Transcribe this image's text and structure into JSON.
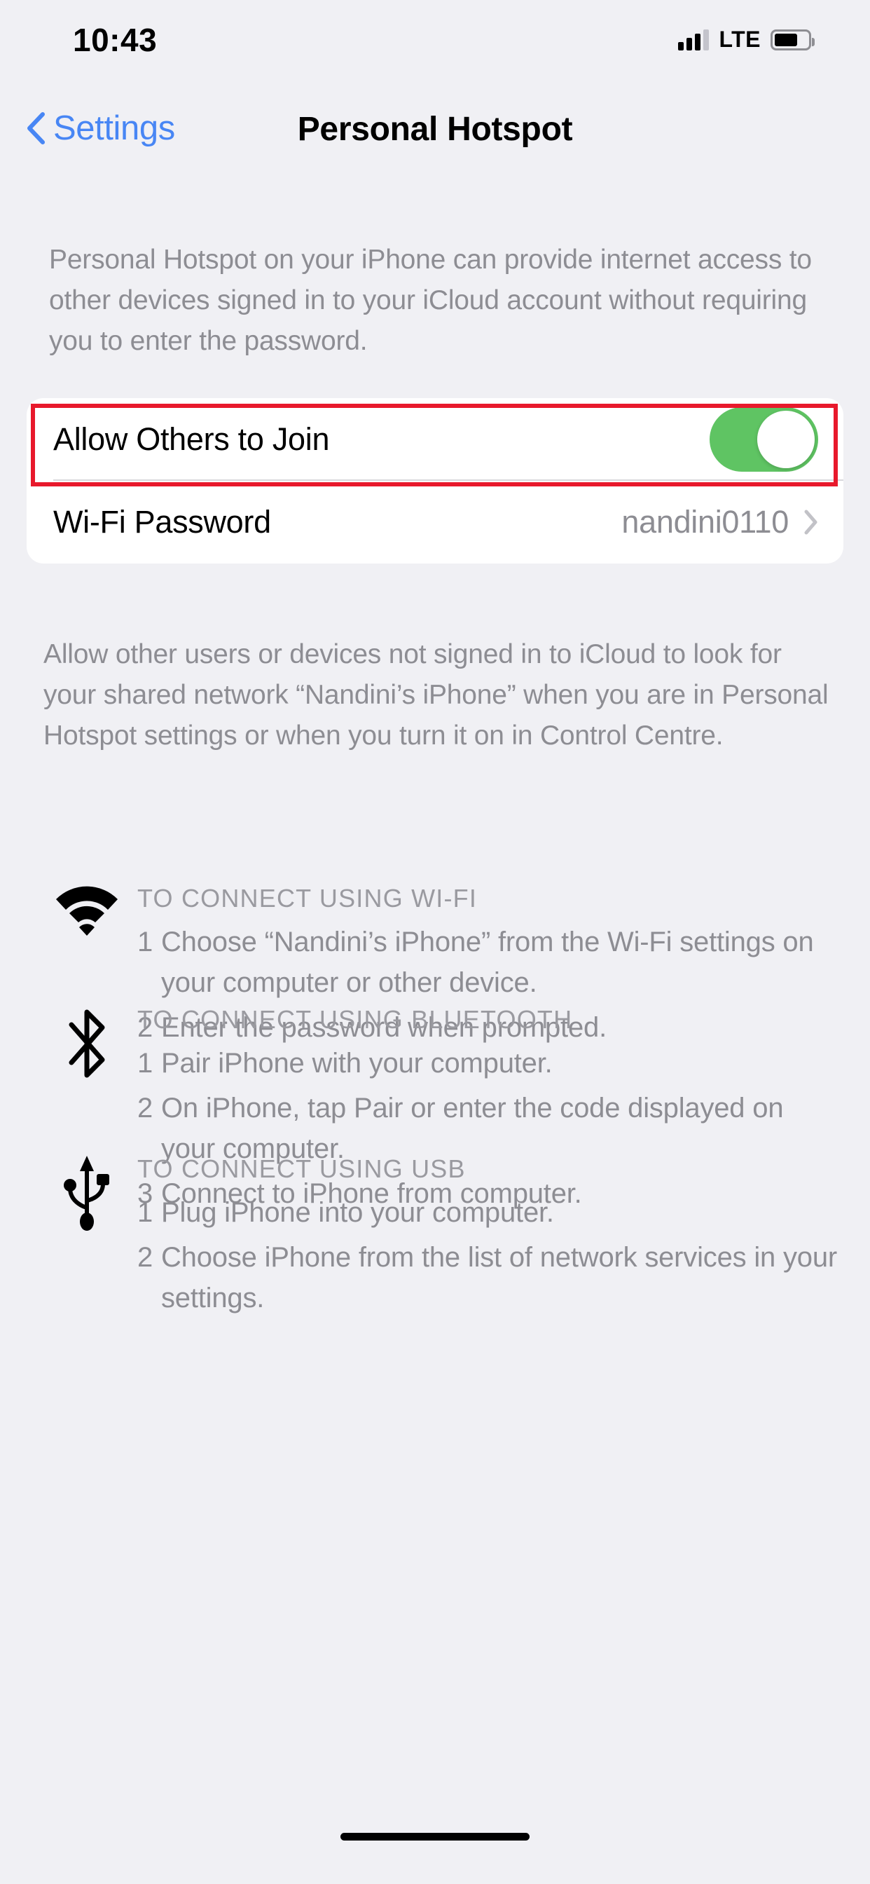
{
  "status_bar": {
    "time": "10:43",
    "carrier_tech": "LTE",
    "signal_icon": "cellular-signal-icon",
    "battery_icon": "battery-icon",
    "battery_level_pct": 70
  },
  "nav": {
    "back_label": "Settings",
    "back_icon": "chevron-left-icon",
    "title": "Personal Hotspot"
  },
  "intro_text": "Personal Hotspot on your iPhone can provide internet access to other devices signed in to your iCloud account without requiring you to enter the password.",
  "settings_group": {
    "allow_others": {
      "label": "Allow Others to Join",
      "toggle_state": "on",
      "toggle_on_color": "#5fc463"
    },
    "wifi_password": {
      "label": "Wi-Fi Password",
      "value": "nandini0110",
      "chevron_icon": "chevron-right-icon"
    }
  },
  "annotation": {
    "highlight_color": "#e8192c",
    "target": "allow-others-to-join-row"
  },
  "footer_text": "Allow other users or devices not signed in to iCloud to look for your shared network “Nandini’s iPhone” when you are in Personal Hotspot settings or when you turn it on in Control Centre.",
  "instructions": [
    {
      "icon": "wifi-icon",
      "heading": "TO CONNECT USING WI-FI",
      "steps": [
        {
          "num": "1",
          "text": "Choose “Nandini’s iPhone” from the Wi-Fi settings on your computer or other device."
        },
        {
          "num": "2",
          "text": "Enter the password when prompted."
        }
      ]
    },
    {
      "icon": "bluetooth-icon",
      "heading": "TO CONNECT USING BLUETOOTH",
      "steps": [
        {
          "num": "1",
          "text": "Pair iPhone with your computer."
        },
        {
          "num": "2",
          "text": "On iPhone, tap Pair or enter the code displayed on your computer."
        },
        {
          "num": "3",
          "text": "Connect to iPhone from computer."
        }
      ]
    },
    {
      "icon": "usb-icon",
      "heading": "TO CONNECT USING USB",
      "steps": [
        {
          "num": "1",
          "text": "Plug iPhone into your computer."
        },
        {
          "num": "2",
          "text": "Choose iPhone from the list of network services in your settings."
        }
      ]
    }
  ],
  "home_indicator": "home-indicator"
}
